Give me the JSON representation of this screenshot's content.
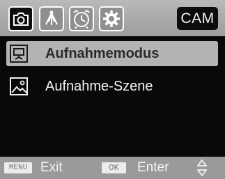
{
  "header": {
    "tabs": [
      {
        "icon": "camera-icon",
        "active": true
      },
      {
        "icon": "antenna-icon",
        "active": false
      },
      {
        "icon": "alarm-clock-icon",
        "active": false
      },
      {
        "icon": "gear-icon",
        "active": false
      }
    ],
    "mode_badge": "CAM"
  },
  "menu": {
    "items": [
      {
        "label": "Aufnahmemodus",
        "icon": "projector-icon",
        "selected": true
      },
      {
        "label": "Aufnahme-Szene",
        "icon": "landscape-icon",
        "selected": false
      }
    ]
  },
  "footer": {
    "menu_key": "MENU",
    "menu_action": "Exit",
    "ok_key": "OK",
    "ok_action": "Enter",
    "nav_icon": "up-down-icon"
  },
  "colors": {
    "screen_bg": "#090909",
    "bar_bg": "#a5a5a5",
    "selection_bg": "#b3b3b3",
    "text_light": "#f4f4f4"
  }
}
